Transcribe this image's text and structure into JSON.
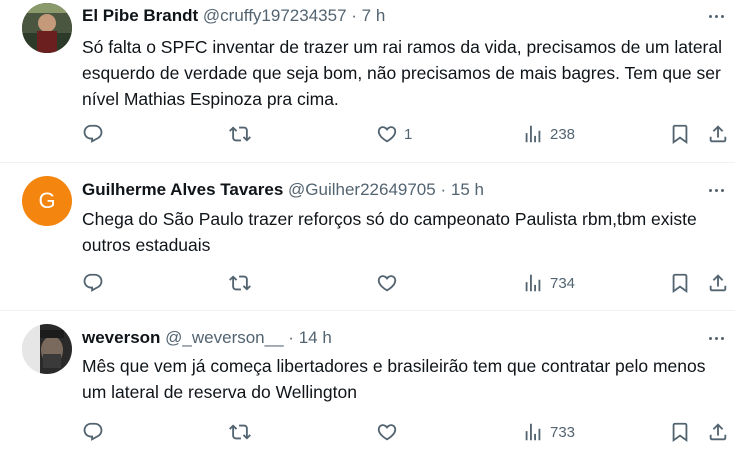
{
  "tweets": [
    {
      "name": "El Pibe Brandt",
      "handle": "@cruffy197234357",
      "separator": "·",
      "time": "7 h",
      "text": "Só falta o SPFC inventar de trazer um rai ramos da vida, precisamos de um lateral esquerdo de verdade que seja bom, não precisamos de mais bagres. Tem que ser nível Mathias Espinoza pra cima.",
      "replies": "",
      "retweets": "",
      "likes": "1",
      "views": "238"
    },
    {
      "name": "Guilherme Alves Tavares",
      "handle": "@Guilher22649705",
      "separator": "·",
      "time": "15 h",
      "avatar_letter": "G",
      "avatar_color": "#f4850f",
      "text": "Chega do São Paulo trazer reforços só do campeonato Paulista rbm,tbm existe outros estaduais",
      "replies": "",
      "retweets": "",
      "likes": "",
      "views": "734"
    },
    {
      "name": "weverson",
      "handle": "@_weverson__",
      "separator": "·",
      "time": "14 h",
      "text": "Mês que vem já começa libertadores e brasileirão tem que contratar pelo menos um lateral de  reserva do Wellington",
      "replies": "",
      "retweets": "",
      "likes": "",
      "views": "733"
    }
  ],
  "icons": {
    "reply": "reply-icon",
    "retweet": "retweet-icon",
    "like": "heart-icon",
    "views": "views-icon",
    "bookmark": "bookmark-icon",
    "share": "share-icon",
    "more": "more-icon"
  },
  "colors": {
    "text": "#0f1419",
    "secondary": "#536471",
    "divider": "#eff3f4"
  }
}
